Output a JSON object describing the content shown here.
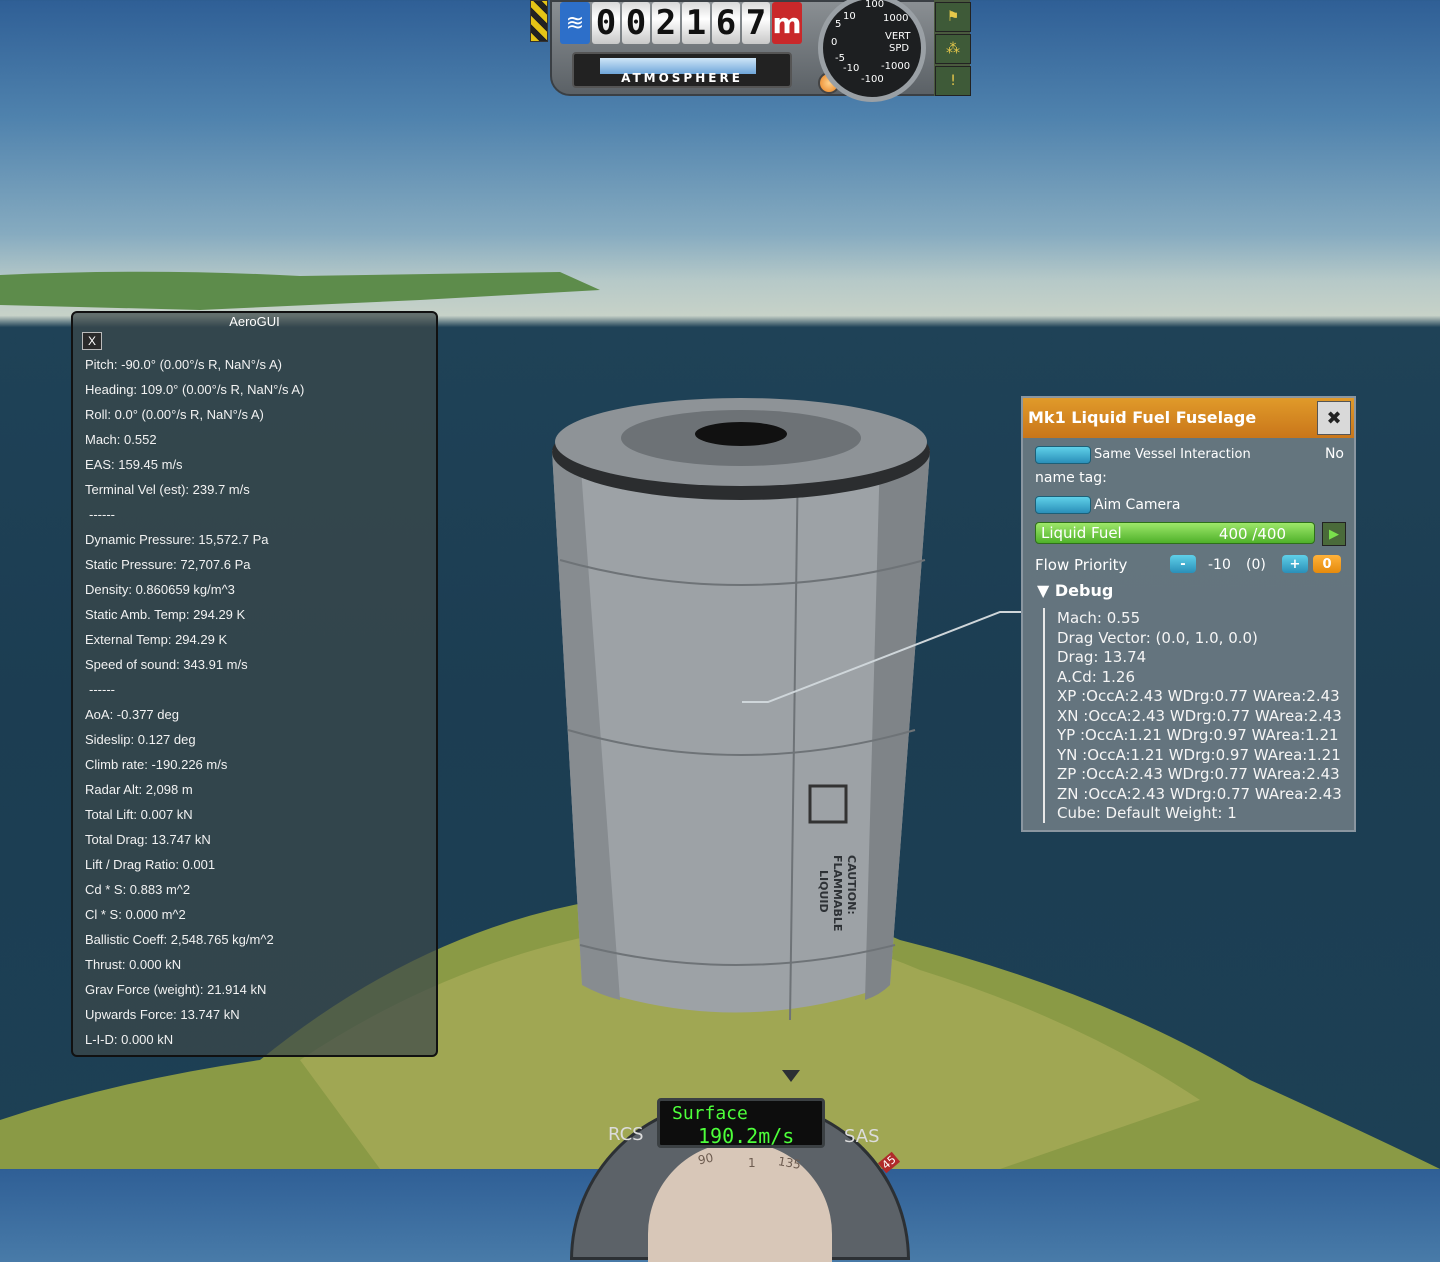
{
  "altimeter": {
    "digits": [
      "0",
      "0",
      "2",
      "1",
      "6",
      "7"
    ],
    "unit": "m",
    "atmosphere_label": "ATMOSPHERE",
    "atmosphere_level": 0.92,
    "vert_label_1": "VERT",
    "vert_label_2": "SPD",
    "dial_ticks": [
      "100",
      "10",
      "1000",
      "5",
      "0",
      "-5",
      "-10",
      "-1000",
      "-100"
    ]
  },
  "aero": {
    "title": "AeroGUI",
    "close_label": "X",
    "lines": [
      "Pitch: -90.0° (0.00°/s R, NaN°/s A)",
      "Heading: 109.0° (0.00°/s R, NaN°/s A)",
      "Roll: 0.0° (0.00°/s R, NaN°/s A)",
      "Mach: 0.552",
      "EAS: 159.45 m/s",
      "Terminal Vel (est): 239.7 m/s",
      "------",
      "Dynamic Pressure: 15,572.7 Pa",
      "Static Pressure: 72,707.6 Pa",
      "Density: 0.860659 kg/m^3",
      "Static Amb. Temp: 294.29 K",
      "External Temp: 294.29 K",
      "Speed of sound: 343.91 m/s",
      "------",
      "AoA: -0.377 deg",
      "Sideslip: 0.127 deg",
      "Climb rate: -190.226 m/s",
      "Radar Alt: 2,098 m",
      "Total Lift: 0.007 kN",
      "Total Drag: 13.747 kN",
      "Lift / Drag Ratio: 0.001",
      "Cd * S: 0.883 m^2",
      "Cl * S: 0.000 m^2",
      "Ballistic Coeff: 2,548.765 kg/m^2",
      "Thrust: 0.000 kN",
      "Grav Force (weight): 21.914 kN",
      "Upwards Force: 13.747 kN",
      "L-I-D: 0.000 kN"
    ]
  },
  "part": {
    "title": "Mk1 Liquid Fuel Fuselage",
    "same_vessel_label": "Same Vessel Interaction",
    "same_vessel_value": "No",
    "name_tag_label": "name tag:",
    "aim_camera_label": "Aim Camera",
    "fuel_name": "Liquid Fuel",
    "fuel_value": "400 /400",
    "fuel_fraction": 1.0,
    "flow_priority_label": "Flow Priority",
    "flow_minus": "-",
    "flow_value": "-10",
    "flow_default": "(0)",
    "flow_plus": "+",
    "flow_reset": "0",
    "debug_label": "Debug",
    "debug_lines": [
      "Mach: 0.55",
      "Drag Vector: (0.0, 1.0, 0.0)",
      "Drag: 13.74",
      "A.Cd: 1.26",
      "XP :OccA:2.43 WDrg:0.77 WArea:2.43",
      "XN :OccA:2.43 WDrg:0.77 WArea:2.43",
      "YP :OccA:1.21 WDrg:0.97 WArea:1.21",
      "YN :OccA:1.21 WDrg:0.97 WArea:1.21",
      "ZP :OccA:2.43 WDrg:0.77 WArea:2.43",
      "ZN :OccA:2.43 WDrg:0.77 WArea:2.43",
      "Cube: Default Weight: 1"
    ]
  },
  "tank_decal": {
    "line1": "CAUTION:",
    "line2": "FLAMMABLE",
    "line3": "LIQUID"
  },
  "navball": {
    "mode": "Surface",
    "speed": "190.2m/s",
    "rcs_label": "RCS",
    "sas_label": "SAS",
    "heading_ticks": [
      "90",
      "1",
      "135",
      "45"
    ]
  }
}
